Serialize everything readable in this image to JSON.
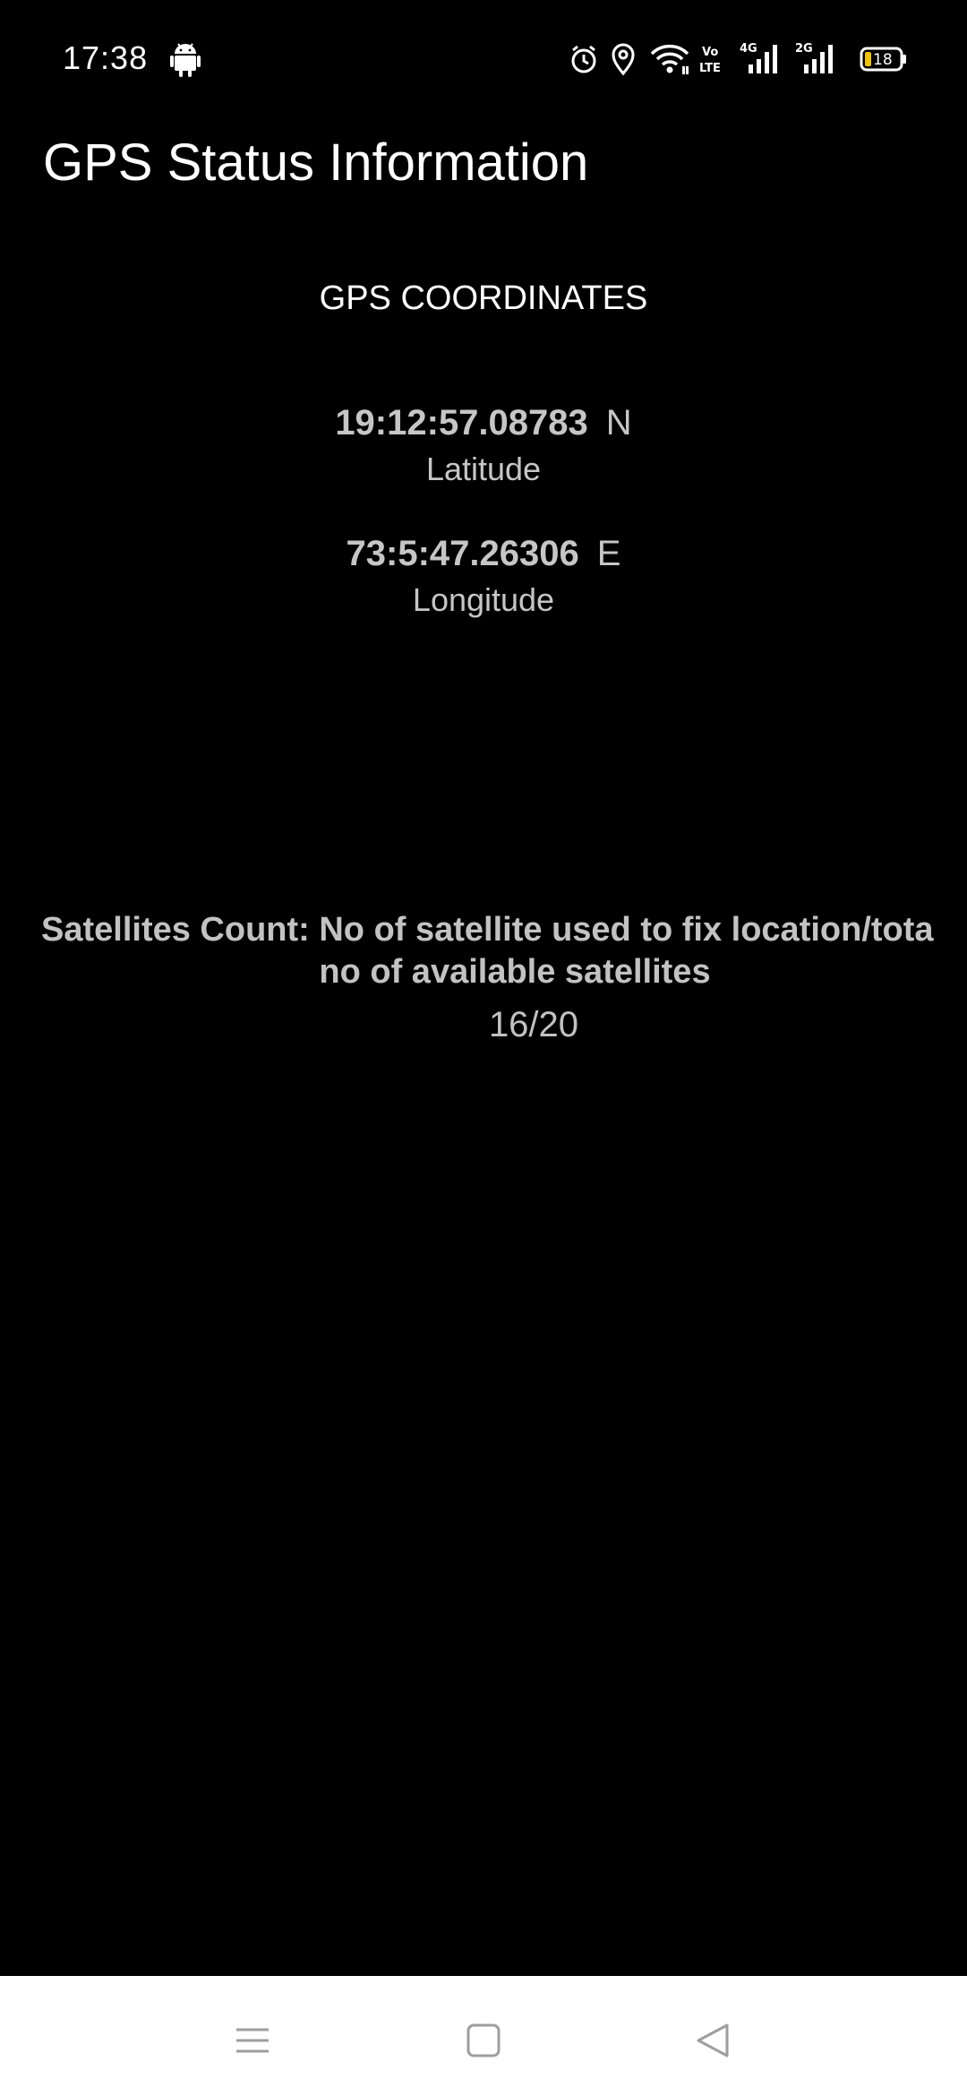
{
  "status_bar": {
    "time": "17:38",
    "network_4g": "4G",
    "network_2g": "2G",
    "volte_line1": "Vo",
    "volte_line2": "LTE",
    "battery_level": "18",
    "icons": [
      "android-icon",
      "alarm-icon",
      "location-icon",
      "wifi-icon",
      "volte-icon",
      "signal-4g-icon",
      "signal-2g-icon",
      "battery-icon"
    ]
  },
  "app": {
    "title": "GPS Status Information"
  },
  "coordinates": {
    "heading": "GPS COORDINATES",
    "latitude": {
      "value": "19:12:57.08783",
      "direction": "N",
      "label": "Latitude"
    },
    "longitude": {
      "value": "73:5:47.26306",
      "direction": "E",
      "label": "Longitude"
    }
  },
  "satellites": {
    "description_line1": "Satellites Count: No of satellite used to fix location/tota",
    "description_line2": "no of available satellites",
    "count": "16/20"
  },
  "nav_bar": {
    "icons": [
      "menu-icon",
      "home-icon",
      "back-icon"
    ]
  },
  "colors": {
    "background": "#000000",
    "primary_text": "#ffffff",
    "secondary_text": "#c6c6c6",
    "nav_bar": "#ffffff",
    "nav_icon": "#9e9e9e",
    "battery_fill": "#f5c400"
  }
}
